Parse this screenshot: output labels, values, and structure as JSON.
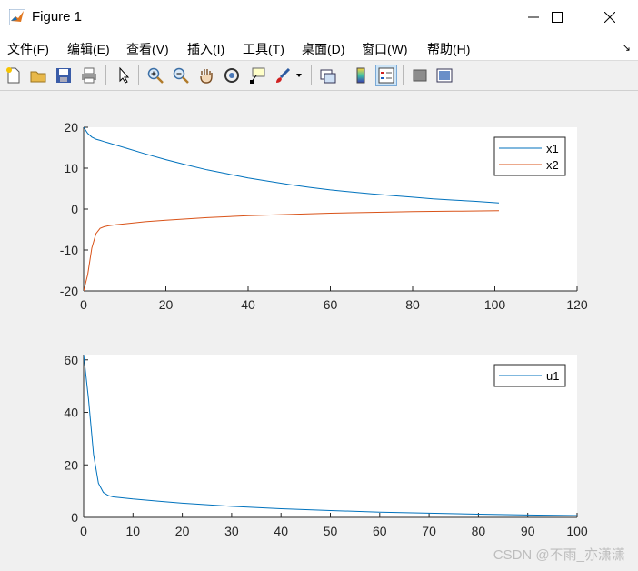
{
  "window": {
    "title": "Figure 1",
    "minimize_symbol": "—",
    "close_symbol": "✕"
  },
  "menu": [
    "文件(F)",
    "编辑(E)",
    "查看(V)",
    "插入(I)",
    "工具(T)",
    "桌面(D)",
    "窗口(W)",
    "帮助(H)"
  ],
  "dock_symbol": "↘",
  "toolbar_icons": [
    "new-figure-icon",
    "open-file-icon",
    "save-icon",
    "print-icon",
    "pointer-icon",
    "zoom-in-icon",
    "zoom-out-icon",
    "pan-hand-icon",
    "rotate-3d-icon",
    "data-cursor-icon",
    "brush-icon",
    "brush-dropdown-icon",
    "link-plot-icon",
    "colorbar-icon",
    "legend-icon",
    "hide-plot-tools-icon",
    "show-plot-tools-icon"
  ],
  "colors": {
    "series1": "#0072BD",
    "series2": "#D95319",
    "background": "#f0f0f0",
    "axes": "#ffffff"
  },
  "watermark": "CSDN @不雨_亦潇潇",
  "chart_data": [
    {
      "type": "line",
      "xlim": [
        0,
        120
      ],
      "ylim": [
        -20,
        20
      ],
      "xticks": [
        "0",
        "20",
        "40",
        "60",
        "80",
        "100",
        "120"
      ],
      "yticks": [
        "20",
        "10",
        "0",
        "-10",
        "-20"
      ],
      "legend_position": "top-right",
      "series": [
        {
          "name": "x1",
          "x": [
            0,
            1,
            2,
            3,
            4,
            5,
            6,
            8,
            10,
            15,
            20,
            25,
            30,
            35,
            40,
            45,
            50,
            55,
            60,
            65,
            70,
            75,
            80,
            85,
            90,
            95,
            101
          ],
          "y": [
            20,
            18.5,
            17.6,
            17.1,
            16.8,
            16.5,
            16.2,
            15.6,
            15.0,
            13.5,
            12.1,
            10.8,
            9.6,
            8.6,
            7.6,
            6.8,
            6.0,
            5.3,
            4.7,
            4.2,
            3.7,
            3.3,
            2.9,
            2.5,
            2.2,
            1.9,
            1.5
          ]
        },
        {
          "name": "x2",
          "x": [
            0,
            1,
            2,
            3,
            4,
            5,
            6,
            8,
            10,
            15,
            20,
            30,
            40,
            50,
            60,
            70,
            80,
            90,
            101
          ],
          "y": [
            -20,
            -16,
            -9.5,
            -6,
            -4.7,
            -4.3,
            -4.1,
            -3.8,
            -3.6,
            -3.1,
            -2.7,
            -2.1,
            -1.6,
            -1.3,
            -1.0,
            -0.8,
            -0.6,
            -0.5,
            -0.4
          ]
        }
      ]
    },
    {
      "type": "line",
      "xlim": [
        0,
        100
      ],
      "ylim": [
        0,
        62
      ],
      "xticks": [
        "0",
        "10",
        "20",
        "30",
        "40",
        "50",
        "60",
        "70",
        "80",
        "90",
        "100"
      ],
      "yticks": [
        "60",
        "40",
        "20",
        "0"
      ],
      "legend_position": "top-right",
      "series": [
        {
          "name": "u1",
          "x": [
            0,
            1,
            2,
            3,
            4,
            5,
            6,
            8,
            10,
            15,
            20,
            30,
            40,
            50,
            60,
            70,
            80,
            90,
            100
          ],
          "y": [
            62,
            45,
            24,
            13,
            9.5,
            8.3,
            7.8,
            7.4,
            7.0,
            6.2,
            5.4,
            4.2,
            3.3,
            2.6,
            2.0,
            1.6,
            1.2,
            0.9,
            0.7
          ]
        }
      ]
    }
  ]
}
